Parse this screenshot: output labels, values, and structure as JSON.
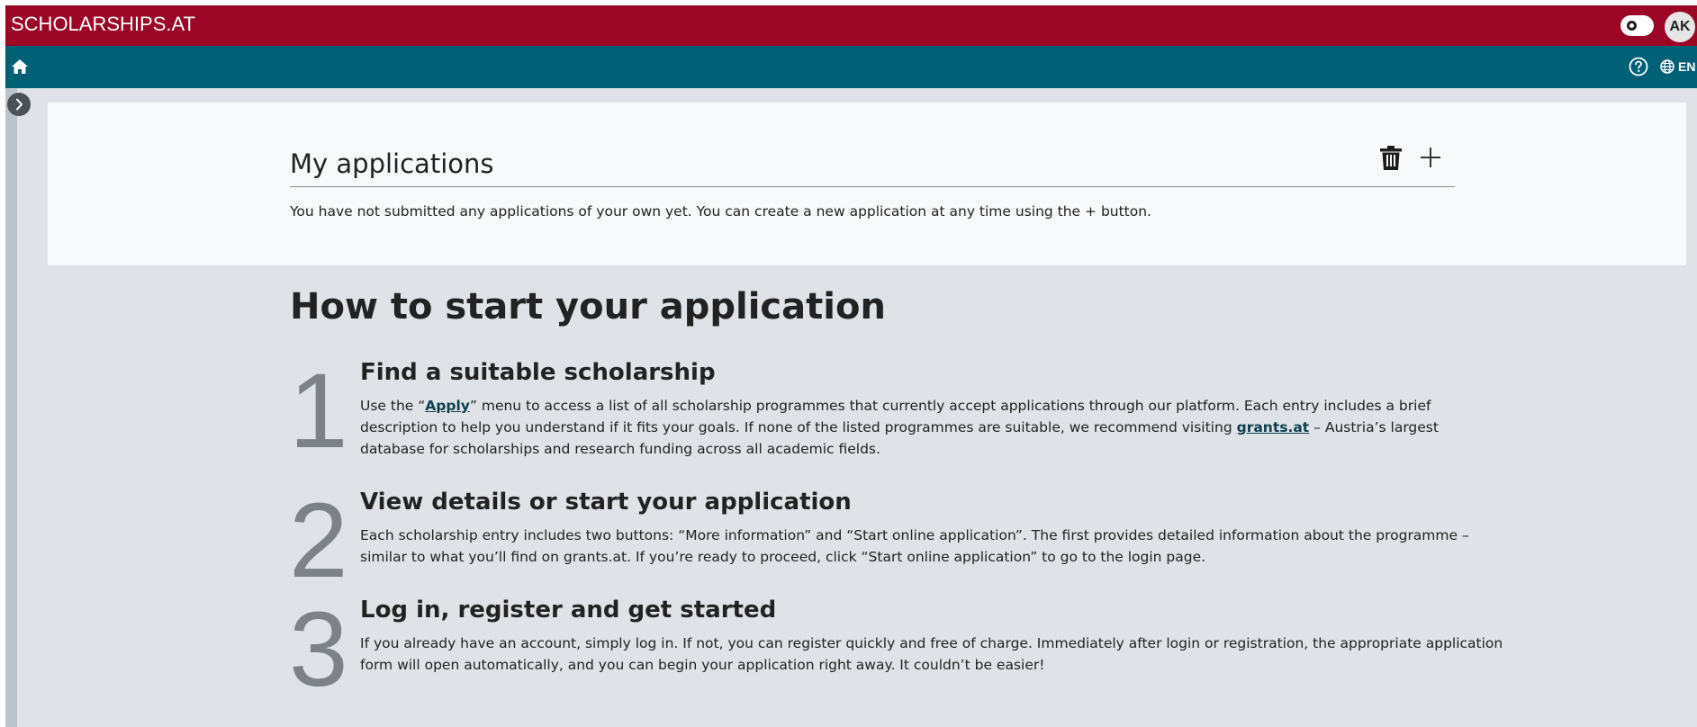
{
  "header": {
    "brand": "SCHOLARSHIPS.AT",
    "avatar_initials": "AK",
    "theme_toggle_icon": "sun-icon"
  },
  "nav": {
    "home_icon": "home-icon",
    "help_icon": "help-circle-icon",
    "language_icon": "globe-icon",
    "language": "EN"
  },
  "sidebar": {
    "toggle_icon": "chevron-right-icon"
  },
  "applications": {
    "title": "My applications",
    "empty_message": "You have not submitted any applications of your own yet. You can create a new application at any time using the + button.",
    "delete_icon": "trash-icon",
    "add_icon": "plus-icon"
  },
  "howto": {
    "title": "How to start your application",
    "steps": [
      {
        "number": "1",
        "title": "Find a suitable scholarship",
        "text_before_link1": "Use the “",
        "link1": "Apply",
        "text_after_link1": "” menu to access a list of all scholarship programmes that currently accept applications through our platform. Each entry includes a brief description to help you understand if it fits your goals. If none of the listed programmes are suitable, we recommend visiting ",
        "link2": "grants.at",
        "text_after_link2": " – Austria’s largest database for scholarships and research funding across all academic fields."
      },
      {
        "number": "2",
        "title": "View details or start your application",
        "text": "Each scholarship entry includes two buttons: “More information” and “Start online application”. The first provides detailed information about the programme – similar to what you’ll find on grants.at. If you’re ready to proceed, click “Start online application” to go to the login page."
      },
      {
        "number": "3",
        "title": "Log in, register and get started",
        "text": "If you already have an account, simply log in. If not, you can register quickly and free of charge. Immediately after login or registration, the appropriate application form will open automatically, and you can begin your application right away. It couldn’t be easier!"
      }
    ]
  },
  "colors": {
    "topbar": "#9b0526",
    "navbar": "#006075",
    "page_bg": "#dfe2e6",
    "card_bg": "#f8f9fa",
    "step_number": "#7d8287"
  }
}
